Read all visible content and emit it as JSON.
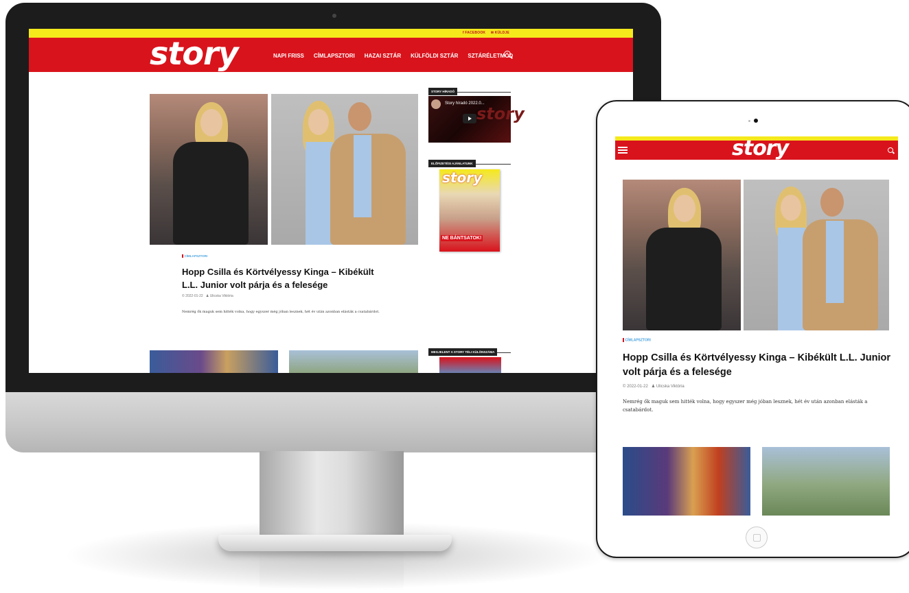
{
  "site": {
    "logo_text": "story",
    "brand_color": "#d9131c",
    "accent_yellow": "#f5e91c"
  },
  "topbar": {
    "facebook": "f FACEBOOK",
    "contact": "✉ KÜLDJE"
  },
  "nav": {
    "items": [
      {
        "label": "NAPI FRISS"
      },
      {
        "label": "CÍMLAPSZTORI"
      },
      {
        "label": "HAZAI SZTÁR"
      },
      {
        "label": "KÜLFÖLDI SZTÁR"
      },
      {
        "label": "SZTÁRÉLETMÓD"
      }
    ]
  },
  "article": {
    "category": "CÍMLAPSZTORI",
    "title": "Hopp Csilla és Körtvélyessy Kinga – Kibékült L.L. Junior volt párja és a felesége",
    "date": "© 2022-01-22",
    "author": "♟ Ulicska Viktória",
    "excerpt": "Nemrég ők maguk sem hitték volna, hogy egyszer még jóban lesznek, hét év után azonban elásták a csatabárdot."
  },
  "sidebar": {
    "video_widget_title": "STORY HÍRADÓ",
    "video_title": "Story híradó 2022.0...",
    "subscription_widget_title": "ELŐFIZETÉSI AJÁNLATUNK",
    "magazine_logo": "story",
    "magazine_banner": "NE BÁNTSATOK!",
    "special_issue_widget_title": "MEGJELENT A STORY TÉLI KÜLÖNSZÁMA"
  }
}
